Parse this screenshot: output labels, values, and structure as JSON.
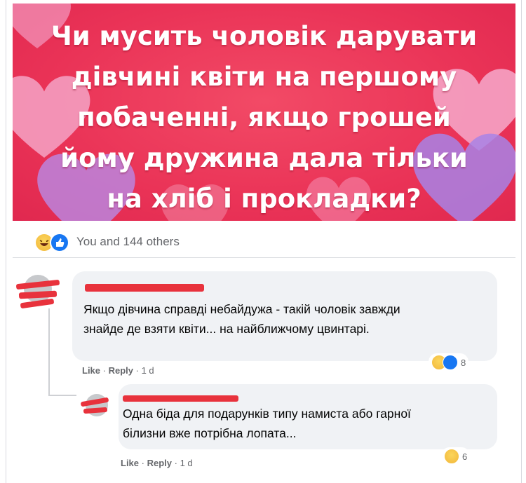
{
  "post": {
    "banner_text": "Чи мусить чоловік дарувати дівчині квіти на першому побаченні, якщо грошей йому дружина дала тільки на хліб і прокладки?",
    "reactions_label": "You and 144 others",
    "reaction_icons": [
      "haha-icon",
      "like-icon"
    ]
  },
  "comments": [
    {
      "author": "",
      "text": "Якщо дівчина справді небайдужа - такій чоловік завжди знайде де взяти квіти... на найближчому цвинтарі.",
      "like": "Like",
      "reply": "Reply",
      "time": "1 d",
      "reaction_count": "8"
    },
    {
      "author": "",
      "text": "Одна біда для подарунків типу намиста або гарної білизни вже потрібна лопата...",
      "like": "Like",
      "reply": "Reply",
      "time": "1 d",
      "reaction_count": "6"
    }
  ],
  "colors": {
    "banner": "#ea3357",
    "heart_pink": "#f6a7c8",
    "heart_purple": "#b38ae8",
    "redaction": "#e8323c",
    "like_blue": "#1877f2",
    "haha_yellow": "#f7c34b"
  }
}
